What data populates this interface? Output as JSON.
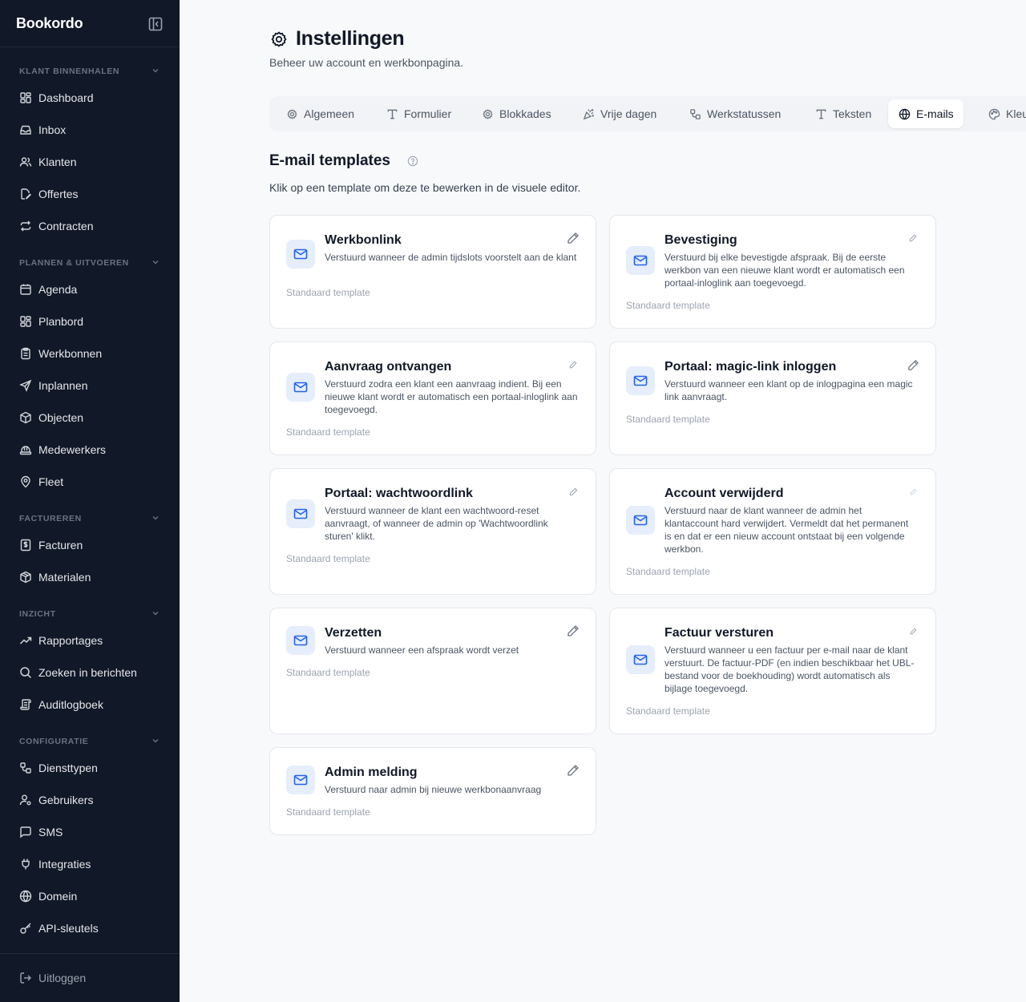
{
  "app": {
    "brand": "Bookordo"
  },
  "sidebar": {
    "sections": [
      {
        "label": "Klant binnenhalen",
        "items": [
          "Dashboard",
          "Inbox",
          "Klanten",
          "Offertes",
          "Contracten"
        ]
      },
      {
        "label": "Plannen & uitvoeren",
        "items": [
          "Agenda",
          "Planbord",
          "Werkbonnen",
          "Inplannen",
          "Objecten",
          "Medewerkers",
          "Fleet"
        ]
      },
      {
        "label": "Factureren",
        "items": [
          "Facturen",
          "Materialen"
        ]
      },
      {
        "label": "Inzicht",
        "items": [
          "Rapportages",
          "Zoeken in berichten",
          "Auditlogboek"
        ]
      },
      {
        "label": "Configuratie",
        "items": [
          "Diensttypen",
          "Gebruikers",
          "SMS",
          "Integraties",
          "Domein",
          "API-sleutels"
        ]
      }
    ],
    "logout": "Uitloggen"
  },
  "page": {
    "title": "Instellingen",
    "subtitle": "Beheer uw account en werkbonpagina."
  },
  "tabs": [
    "Algemeen",
    "Formulier",
    "Blokkades",
    "Vrije dagen",
    "Werkstatussen",
    "Teksten",
    "E-mails",
    "Kleuren"
  ],
  "active_tab": "E-mails",
  "templates_section": {
    "title": "E-mail templates",
    "description": "Klik op een template om deze te bewerken in de visuele editor."
  },
  "templates": [
    {
      "title": "Werkbonlink",
      "description": "Verstuurd wanneer de admin tijdslots voorstelt aan de klant",
      "footer": "Standaard template"
    },
    {
      "title": "Bevestiging",
      "description": "Verstuurd bij elke bevestigde afspraak. Bij de eerste werkbon van een nieuwe klant wordt er automatisch een portaal-inloglink aan toegevoegd.",
      "footer": "Standaard template"
    },
    {
      "title": "Aanvraag ontvangen",
      "description": "Verstuurd zodra een klant een aanvraag indient. Bij een nieuwe klant wordt er automatisch een portaal-inloglink aan toegevoegd.",
      "footer": "Standaard template"
    },
    {
      "title": "Portaal: magic-link inloggen",
      "description": "Verstuurd wanneer een klant op de inlogpagina een magic link aanvraagt.",
      "footer": "Standaard template"
    },
    {
      "title": "Portaal: wachtwoordlink",
      "description": "Verstuurd wanneer de klant een wachtwoord-reset aanvraagt, of wanneer de admin op 'Wachtwoordlink sturen' klikt.",
      "footer": "Standaard template"
    },
    {
      "title": "Account verwijderd",
      "description": "Verstuurd naar de klant wanneer de admin het klantaccount hard verwijdert. Vermeldt dat het permanent is en dat er een nieuw account ontstaat bij een volgende werkbon.",
      "footer": "Standaard template"
    },
    {
      "title": "Verzetten",
      "description": "Verstuurd wanneer een afspraak wordt verzet",
      "footer": "Standaard template"
    },
    {
      "title": "Factuur versturen",
      "description": "Verstuurd wanneer u een factuur per e-mail naar de klant verstuurt. De factuur-PDF (en indien beschikbaar het UBL-bestand voor de boekhouding) wordt automatisch als bijlage toegevoegd.",
      "footer": "Standaard template"
    },
    {
      "title": "Admin melding",
      "description": "Verstuurd naar admin bij nieuwe werkbonaanvraag",
      "footer": "Standaard template"
    }
  ],
  "colors": {
    "sidebar_bg": "#111827",
    "accent": "#2563eb",
    "mail_icon_bg": "#e6eefc"
  }
}
